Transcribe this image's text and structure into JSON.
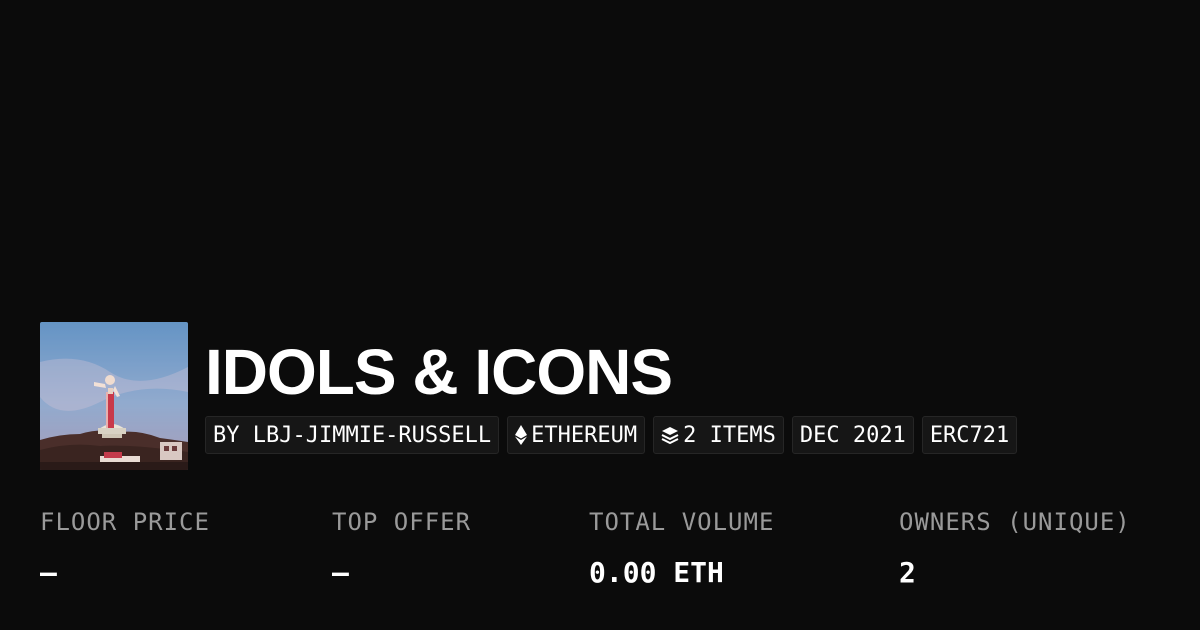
{
  "collection": {
    "title": "IDOLS & ICONS",
    "tags": {
      "creator": "BY LBJ-JIMMIE-RUSSELL",
      "chain": "ETHEREUM",
      "items": "2 ITEMS",
      "date": "DEC 2021",
      "standard": "ERC721"
    },
    "tag_icons": {
      "chain": "ethereum-icon",
      "items": "layers-icon"
    }
  },
  "stats": [
    {
      "label": "FLOOR PRICE",
      "value": "–"
    },
    {
      "label": "TOP OFFER",
      "value": "–"
    },
    {
      "label": "TOTAL VOLUME",
      "value": "0.00 ETH"
    },
    {
      "label": "OWNERS (UNIQUE)",
      "value": "2"
    }
  ],
  "colors": {
    "background": "#0b0b0b",
    "text": "#ffffff",
    "muted": "#9a9a9a",
    "tag_background": "#161616"
  }
}
